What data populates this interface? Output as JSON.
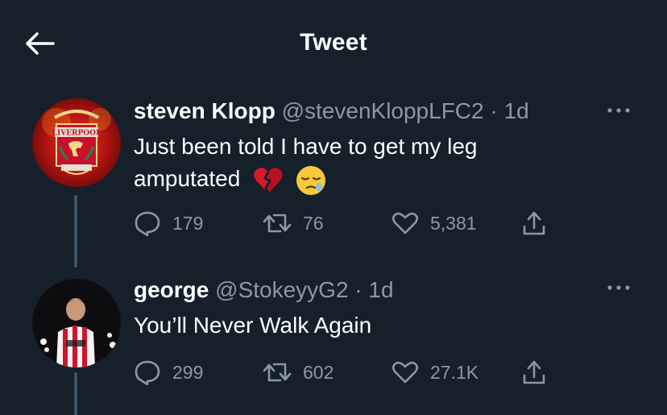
{
  "header": {
    "title": "Tweet",
    "back_icon": "arrow-left-icon"
  },
  "colors": {
    "background": "#15202b",
    "text": "#ffffff",
    "secondary": "#8b98a5",
    "thread_line": "#3d5466"
  },
  "tweets": [
    {
      "avatar": "liverpool-crest-avatar",
      "avatar_crest_text": "LIVERPOOL",
      "name": "steven Klopp",
      "handle": "@stevenKloppLFC2",
      "separator": "·",
      "time": "1d",
      "text_line1": "Just been told I have to get my leg",
      "text_line2": "amputated",
      "emojis": [
        "broken-heart-emoji",
        "sleepy-face-emoji"
      ],
      "replies": "179",
      "retweets": "76",
      "likes": "5,381"
    },
    {
      "avatar": "player-photo-avatar",
      "name": "george",
      "handle": "@StokeyyG2",
      "separator": "·",
      "time": "1d",
      "text_line1": "You’ll Never Walk Again",
      "replies": "299",
      "retweets": "602",
      "likes": "27.1K"
    }
  ]
}
